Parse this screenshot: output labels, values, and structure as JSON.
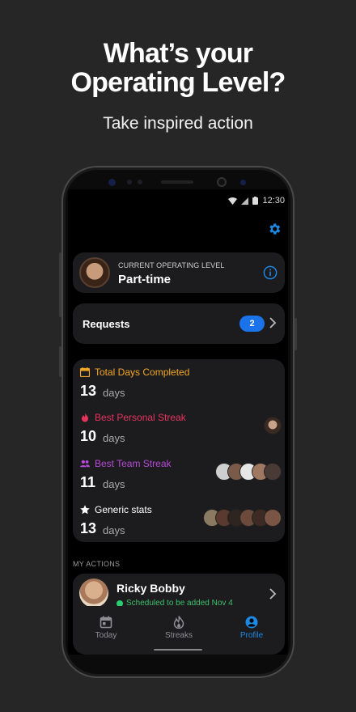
{
  "promo": {
    "headline_line1": "What’s your",
    "headline_line2": "Operating Level?",
    "subheadline": "Take inspired action"
  },
  "status_bar": {
    "time": "12:30"
  },
  "icons": {
    "settings": "gear-icon",
    "info": "info-icon",
    "chevron": "chevron-right-icon",
    "total_days": "calendar-icon",
    "personal_streak": "flame-icon",
    "team_streak": "people-icon",
    "generic": "star-icon"
  },
  "colors": {
    "accent": "#1a73e8",
    "total_days": "#f5a623",
    "personal_streak": "#e8335f",
    "team_streak": "#b74ad9",
    "status_ok": "#2ecc71"
  },
  "level": {
    "caption": "CURRENT OPERATING LEVEL",
    "value": "Part-time"
  },
  "requests": {
    "label": "Requests",
    "count": "2"
  },
  "stats": [
    {
      "label": "Total Days Completed",
      "value": "13",
      "unit": "days"
    },
    {
      "label": "Best Personal Streak",
      "value": "10",
      "unit": "days"
    },
    {
      "label": "Best Team Streak",
      "value": "11",
      "unit": "days"
    },
    {
      "label": "Generic stats",
      "value": "13",
      "unit": "days"
    }
  ],
  "my_actions": {
    "section_label": "MY ACTIONS",
    "items": [
      {
        "name": "Ricky Bobby",
        "status": "Scheduled to be added Nov 4"
      }
    ]
  },
  "tabs": [
    {
      "label": "Today",
      "icon": "calendar-icon"
    },
    {
      "label": "Streaks",
      "icon": "flame-icon"
    },
    {
      "label": "Profile",
      "icon": "person-icon"
    }
  ]
}
